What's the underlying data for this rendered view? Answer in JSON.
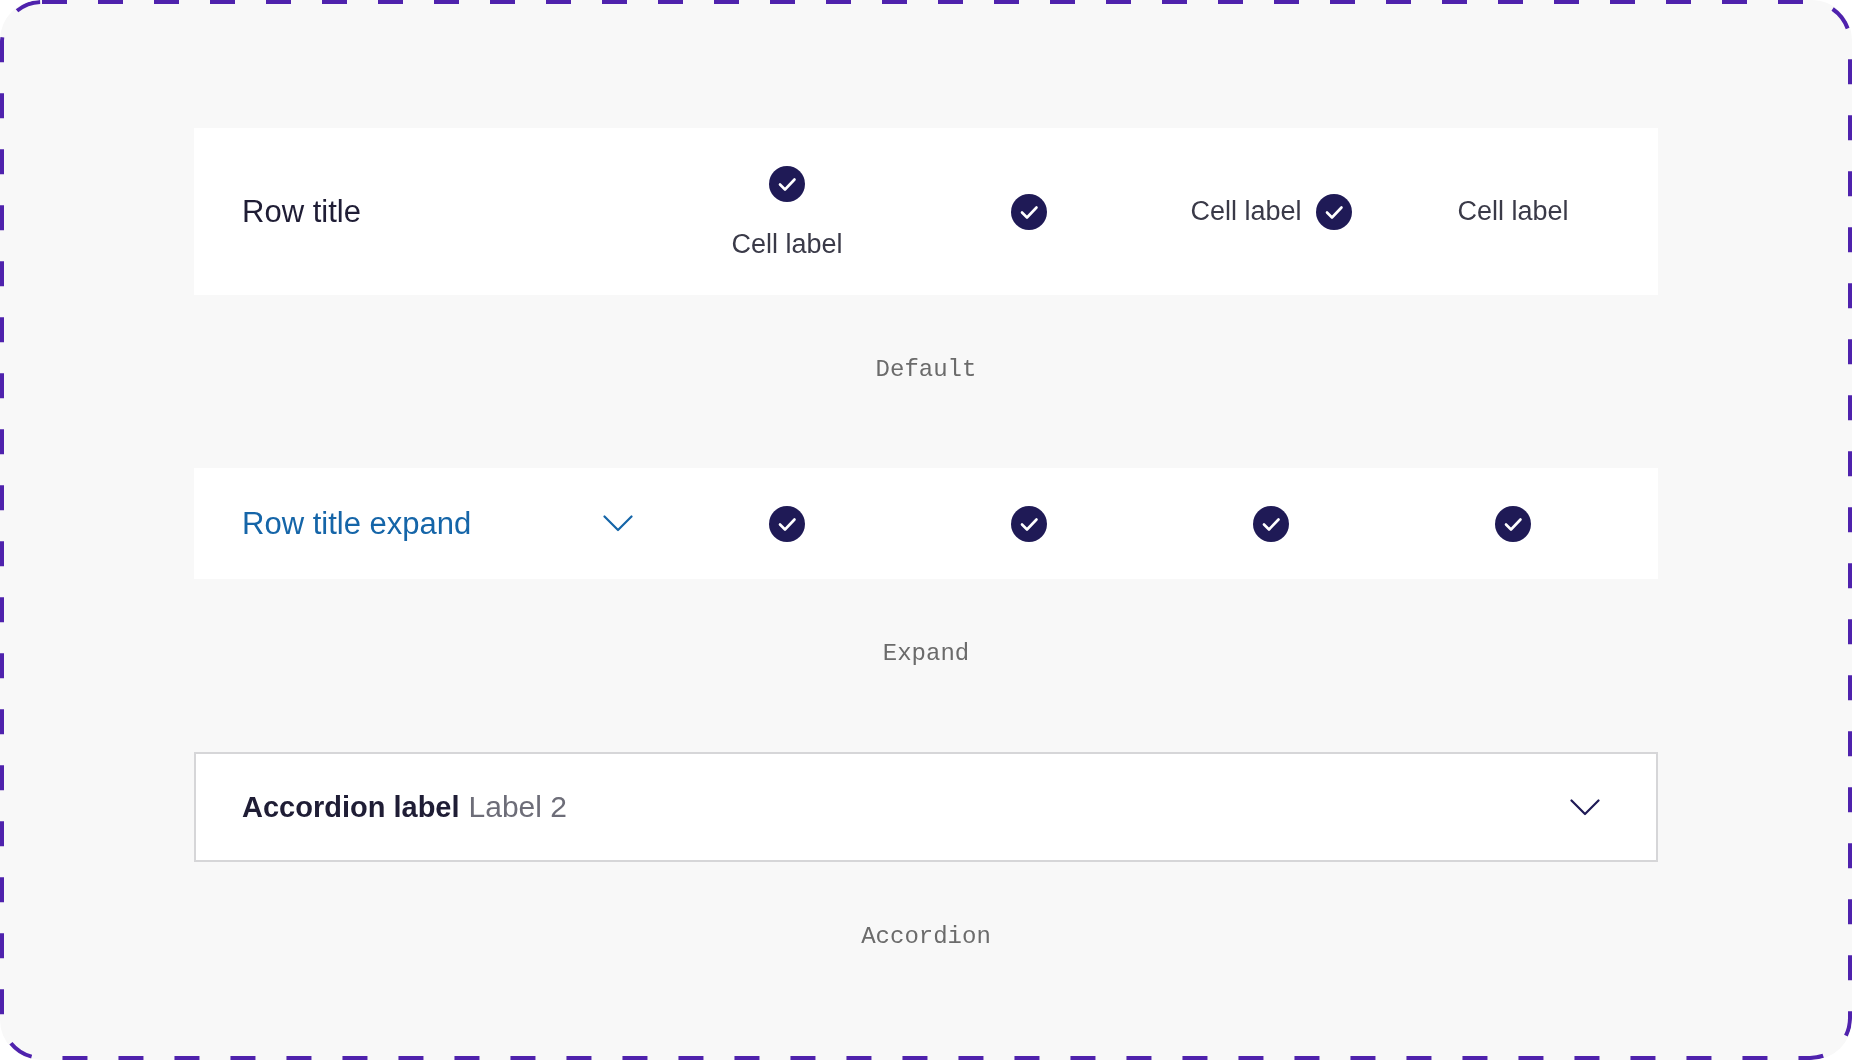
{
  "examples": [
    {
      "kind": "table_row",
      "title": "Row title",
      "cells": [
        {
          "kind": "icon_above_label",
          "label": "Cell label"
        },
        {
          "kind": "icon"
        },
        {
          "kind": "label_icon",
          "label": "Cell label"
        },
        {
          "kind": "label",
          "label": "Cell label"
        }
      ],
      "caption": "Default"
    },
    {
      "kind": "expand_row",
      "title": "Row title expand",
      "expanded": false,
      "cells": [
        {
          "kind": "icon"
        },
        {
          "kind": "icon"
        },
        {
          "kind": "icon"
        },
        {
          "kind": "icon"
        }
      ],
      "caption": "Expand"
    },
    {
      "kind": "accordion",
      "label": "Accordion label",
      "secondary_label": "Label 2",
      "expanded": false,
      "caption": "Accordion"
    }
  ]
}
